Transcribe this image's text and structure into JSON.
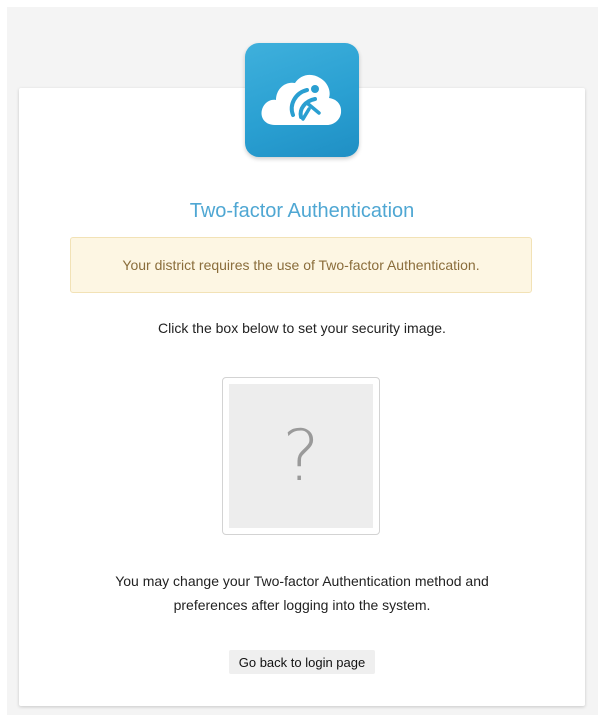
{
  "app": {
    "logo_icon": "cloud-figure-icon",
    "accent_color": "#4fa7d3",
    "logo_color": "#2aa0d2"
  },
  "card": {
    "title": "Two-factor Authentication",
    "alert_text": "Your district requires the use of Two-factor Authentication.",
    "instruction": "Click the box below to set your security image.",
    "security_image": {
      "placeholder_glyph": "?",
      "icon": "question-mark-icon"
    },
    "note_line1": "You may change your Two-factor Authentication method and",
    "note_line2": "preferences after logging into the system.",
    "back_button_label": "Go back to login page"
  }
}
